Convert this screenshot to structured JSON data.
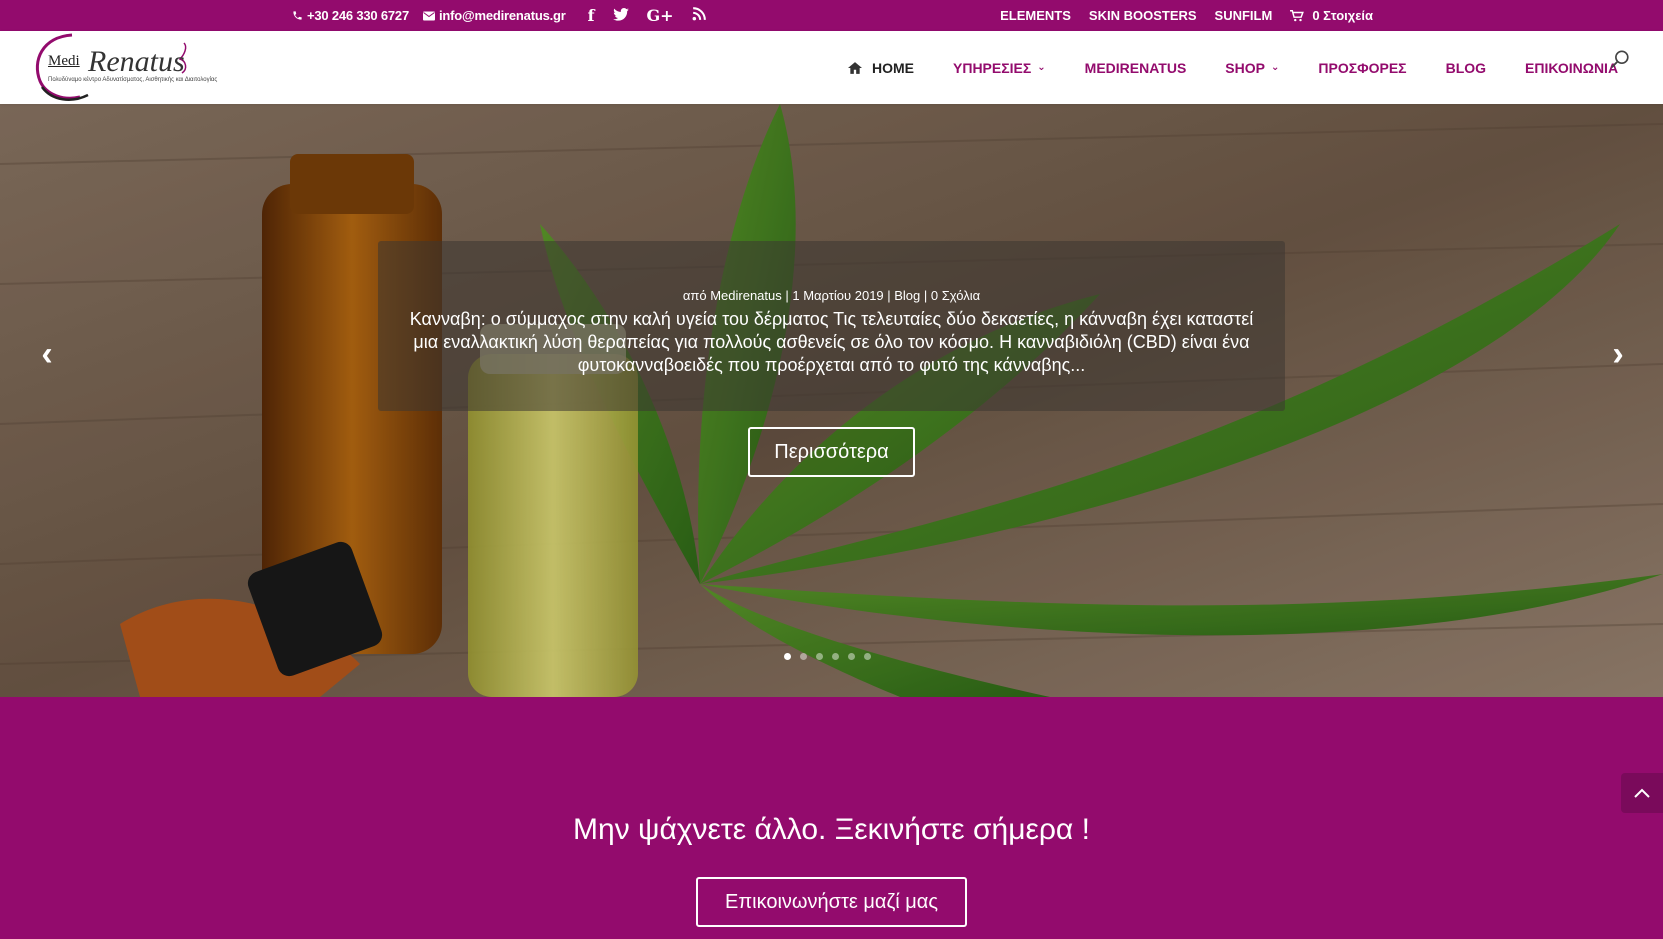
{
  "topbar": {
    "phone": "+30 246 330 6727",
    "email": "info@medirenatus.gr",
    "social": [
      "f",
      "t",
      "G+",
      "rss"
    ],
    "links": [
      "ELEMENTS",
      "SKIN BOOSTERS",
      "SUNFILM"
    ],
    "cart": "0 Στοιχεία"
  },
  "logo": {
    "medi": "Medi",
    "renatus": "Renatus",
    "tagline": "Πολυδύναμο κέντρο Αδυνατίσματος, Αισθητικής και Διαιτολογίας"
  },
  "nav": {
    "items": [
      "HOME",
      "ΥΠΗΡΕΣΙΕΣ",
      "MEDIRENATUS",
      "SHOP",
      "ΠΡΟΣΦΟΡΕΣ",
      "BLOG",
      "ΕΠΙΚΟΙΝΩΝΙΑ"
    ]
  },
  "slider": {
    "meta": "από Medirenatus | 1 Μαρτίου 2019 | Blog | 0 Σχόλια",
    "excerpt": "Κανναβη: ο σύμμαχος στην καλή υγεία του δέρματος Τις τελευταίες δύο δεκαετίες, η κάνναβη έχει καταστεί μια εναλλακτική λύση θεραπείας για πολλούς ασθενείς σε όλο τον κόσμο. Η κανναβιδιόλη (CBD) είναι ένα φυτοκανναβοειδές που προέρχεται από το φυτό της κάνναβης...",
    "button": "Περισσότερα",
    "prev": "‹",
    "next": "›",
    "slide_count": 6,
    "active_slide": 1
  },
  "cta": {
    "heading": "Μην ψάχνετε άλλο. Ξεκινήστε σήμερα !",
    "button": "Επικοινωνήστε μαζί μας"
  },
  "colors": {
    "brand": "#930b6d",
    "white": "#ffffff"
  }
}
